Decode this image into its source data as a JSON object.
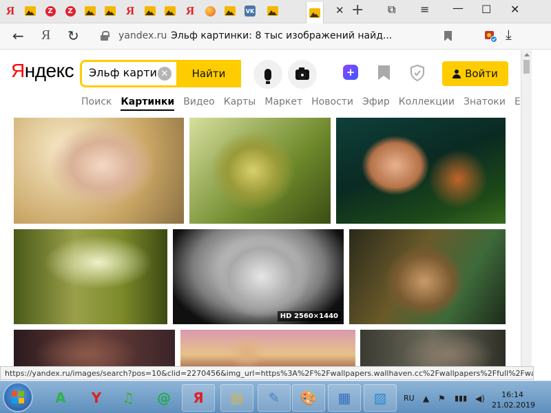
{
  "browser": {
    "tabs": [
      {
        "icon": "yandex-favicon",
        "glyph": "Я"
      },
      {
        "icon": "images-favicon"
      },
      {
        "icon": "zen-favicon",
        "glyph": "Z"
      },
      {
        "icon": "zen-favicon",
        "glyph": "Z"
      },
      {
        "icon": "images-favicon"
      },
      {
        "icon": "images-favicon"
      },
      {
        "icon": "yandex-favicon",
        "glyph": "Я"
      },
      {
        "icon": "images-favicon"
      },
      {
        "icon": "images-favicon"
      },
      {
        "icon": "yandex-favicon",
        "glyph": "Я"
      },
      {
        "icon": "orange-favicon"
      },
      {
        "icon": "images-favicon"
      },
      {
        "icon": "vk-favicon",
        "glyph": "VK"
      },
      {
        "icon": "images-favicon"
      },
      {
        "icon": "images-favicon",
        "active": true
      }
    ],
    "close_tab_glyph": "✕",
    "new_tab_glyph": "+",
    "back_glyph": "←",
    "home_glyph": "Я",
    "reload_glyph": "↻",
    "url_domain": "yandex.ru",
    "page_title": "Эльф картинки: 8 тыс изображений найд...",
    "status_url": "https://yandex.ru/images/search?pos=10&clid=2270456&img_url=https%3A%2F%2Fwallpapers.wallhaven.cc%2Fwallpapers%2Ffull%2Fwa...",
    "window_controls": {
      "restore": "⧉",
      "menu": "≡",
      "minimize": "—",
      "maximize": "☐",
      "close": "✕"
    }
  },
  "yandex": {
    "logo_first": "Я",
    "logo_rest": "ндекс",
    "search_value": "Эльф карти",
    "search_button": "Найти",
    "clear_glyph": "✕",
    "efir_glyph": "+",
    "login_button": "Войти",
    "services": [
      {
        "label": "Поиск"
      },
      {
        "label": "Картинки",
        "active": true
      },
      {
        "label": "Видео"
      },
      {
        "label": "Карты"
      },
      {
        "label": "Маркет"
      },
      {
        "label": "Новости"
      },
      {
        "label": "Эфир"
      },
      {
        "label": "Коллекции"
      },
      {
        "label": "Знатоки"
      },
      {
        "label": "Ещё"
      }
    ],
    "hd_badge": "HD 2560×1440",
    "colors": {
      "accent": "#ffcc00",
      "logo_red": "#ff0000"
    }
  },
  "taskbar": {
    "pinned": [
      {
        "icon": "app-green-icon",
        "glyph": "A"
      },
      {
        "icon": "yandex-browser-icon",
        "glyph": "Y"
      },
      {
        "icon": "music-icon",
        "glyph": "♫"
      },
      {
        "icon": "mail-icon",
        "glyph": "@"
      },
      {
        "icon": "yandex-icon",
        "glyph": "Я"
      },
      {
        "icon": "explorer-icon",
        "glyph": "▤"
      },
      {
        "icon": "notepad-icon",
        "glyph": "✎"
      },
      {
        "icon": "paint-icon",
        "glyph": "🎨"
      },
      {
        "icon": "control-panel-icon",
        "glyph": "▦"
      },
      {
        "icon": "photo-viewer-icon",
        "glyph": "▨"
      }
    ],
    "lang": "RU",
    "time": "16:14",
    "date": "21.02.2019"
  }
}
